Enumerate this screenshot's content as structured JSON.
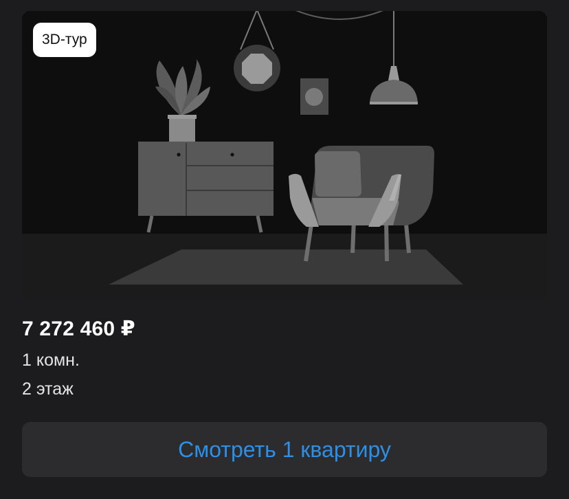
{
  "card": {
    "badge_label": "3D-тур",
    "price": "7 272 460 ₽",
    "rooms": "1 комн.",
    "floor": "2 этаж",
    "button_label": "Смотреть 1 квартиру"
  },
  "colors": {
    "background": "#1c1c1e",
    "button_background": "#2c2c2e",
    "button_text": "#2d8fe6",
    "price_text": "#ffffff",
    "badge_background": "#ffffff"
  },
  "illustration": {
    "icon": "room-interior-illustration"
  }
}
